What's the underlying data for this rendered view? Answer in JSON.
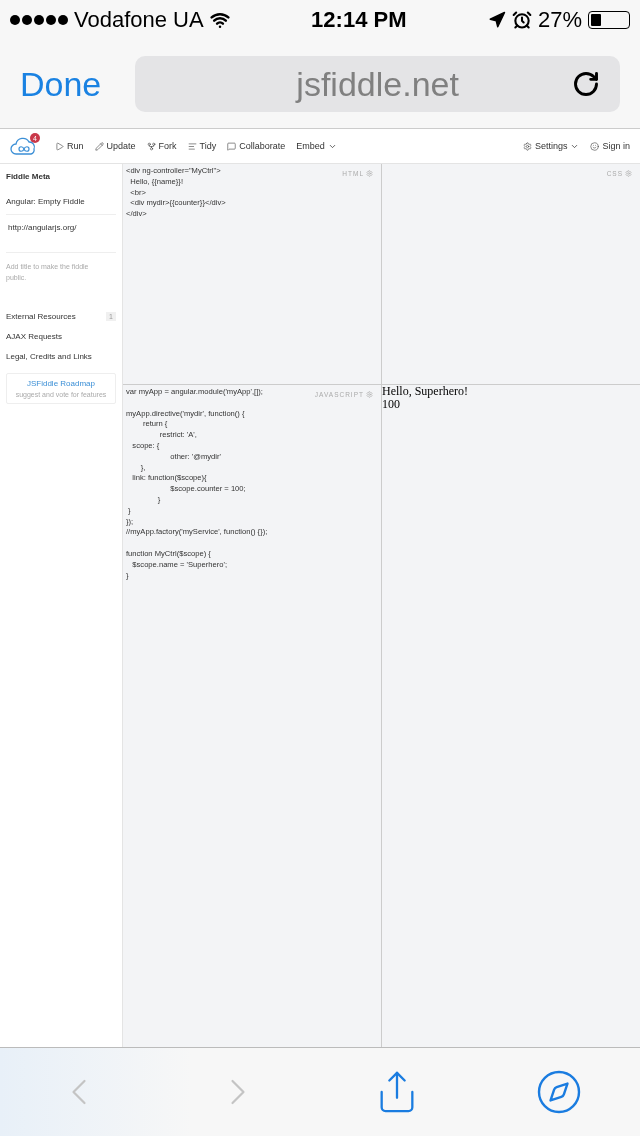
{
  "status_bar": {
    "carrier": "Vodafone UA",
    "time": "12:14 PM",
    "battery": "27%"
  },
  "browser": {
    "done": "Done",
    "address": "jsfiddle.net"
  },
  "toolbar": {
    "badge": "4",
    "actions": [
      {
        "kind": "run",
        "label": "Run"
      },
      {
        "kind": "update",
        "label": "Update"
      },
      {
        "kind": "fork",
        "label": "Fork"
      },
      {
        "kind": "tidy",
        "label": "Tidy"
      },
      {
        "kind": "collaborate",
        "label": "Collaborate"
      },
      {
        "kind": "embed",
        "label": "Embed"
      }
    ],
    "right": [
      {
        "kind": "settings",
        "label": "Settings"
      },
      {
        "kind": "signin",
        "label": "Sign in"
      }
    ]
  },
  "sidebar": {
    "heading": "Fiddle Meta",
    "title": "Angular: Empty Fiddle",
    "url": "http://angularjs.org/",
    "hint": "Add title to make the fiddle public.",
    "items": [
      {
        "label": "External Resources",
        "count": "1"
      },
      {
        "label": "AJAX Requests"
      },
      {
        "label": "Legal, Credits and Links"
      }
    ],
    "roadmap": {
      "title": "JSFiddle Roadmap",
      "subtitle": "suggest and vote for features"
    }
  },
  "panes": {
    "html": {
      "label": "HTML",
      "code": "<div ng-controller=\"MyCtrl\">\n  Hello, {{name}}!\n  <br>\n  <div mydir>{{counter}}</div>\n</div>"
    },
    "css": {
      "label": "CSS"
    },
    "javascript": {
      "label": "JAVASCRIPT",
      "code": "var myApp = angular.module('myApp',[]);\n\nmyApp.directive('mydir', function() {\n        return {\n                restrict: 'A',\n   scope: {\n                     other: '@mydir'\n       },\n   link: function($scope){\n                     $scope.counter = 100;\n               }\n }\n});\n//myApp.factory('myService', function() {});\n\nfunction MyCtrl($scope) {\n   $scope.name = 'Superhero';\n}"
    },
    "result": {
      "lines": [
        "Hello, Superhero!",
        "100"
      ]
    }
  }
}
